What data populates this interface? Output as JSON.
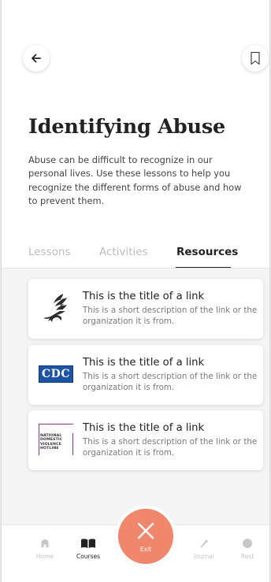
{
  "page": {
    "title": "Identifying Abuse",
    "description": "Abuse can be difficult to recognize in our personal lives. Use these lessons to help you recognize the different forms of abuse and how to prevent them."
  },
  "tabs": [
    {
      "label": "Lessons",
      "active": false
    },
    {
      "label": "Activities",
      "active": false
    },
    {
      "label": "Resources",
      "active": true
    }
  ],
  "resources": [
    {
      "logo": "eagle-logo-icon",
      "title": "This is the title of a link",
      "description": "This is a short description of the link or the organization it is from."
    },
    {
      "logo_text": "CDC",
      "title": "This is the title of a link",
      "description": "This is a short description of the link or the organization it is from."
    },
    {
      "logo_text": "NATIONAL DOMESTIC VIOLENCE HOTLINE",
      "logo_lines": [
        "NATIONAL",
        "DOMESTIC",
        "VIOLENCE",
        "HOTLINE"
      ],
      "title": "This is the title of a link",
      "description": "This is a short description of the link or the organization it is from."
    }
  ],
  "bottom_nav": {
    "items": [
      {
        "label": "Home",
        "icon": "home-icon"
      },
      {
        "label": "Courses",
        "icon": "book-icon"
      },
      {
        "label": "Journal",
        "icon": "pencil-icon"
      },
      {
        "label": "Rest",
        "icon": "circle-icon"
      }
    ],
    "exit_label": "Exit"
  },
  "colors": {
    "accent": "#f0866b",
    "cdc_blue": "#1b54a4",
    "hotline_purple": "#8b3a8f"
  }
}
